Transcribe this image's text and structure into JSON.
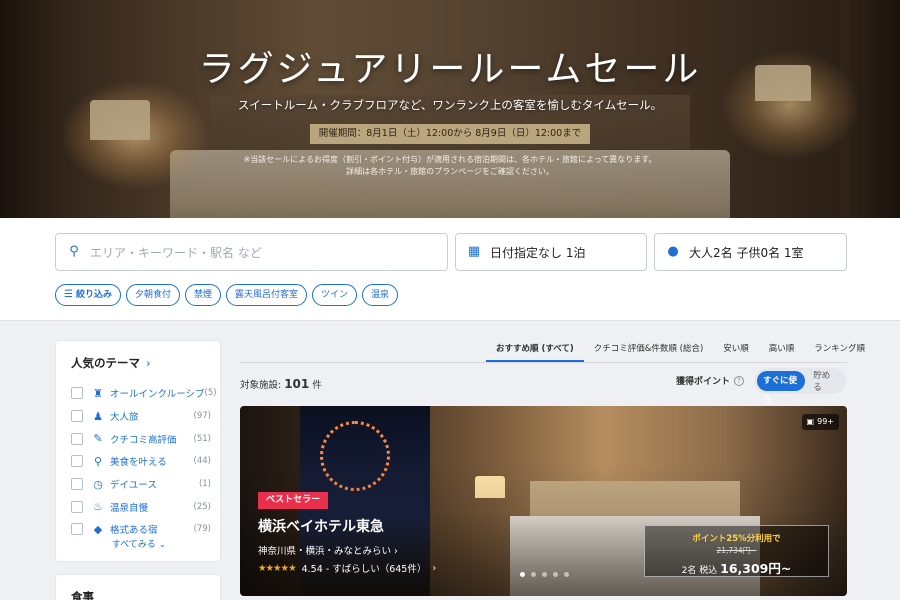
{
  "hero": {
    "title": "ラグジュアリールームセール",
    "subtitle": "スイートルーム・クラブフロアなど、ワンランク上の客室を愉しむタイムセール。",
    "period": "開催期間：8月1日（土）12:00から 8月9日（日）12:00まで",
    "note1": "※当該セールによるお得度（割引・ポイント付与）が適用される宿泊期間は、各ホテル・旅館によって異なります。",
    "note2": "詳細は各ホテル・旅館のプランページをご確認ください。"
  },
  "search": {
    "keyword_placeholder": "エリア・キーワード・駅名 など",
    "date_value": "日付指定なし 1泊",
    "guests_value": "大人2名  子供0名  1室"
  },
  "chips": [
    "絞り込み",
    "夕朝食付",
    "禁煙",
    "露天風呂付客室",
    "ツイン",
    "温泉"
  ],
  "themes": {
    "title": "人気のテーマ",
    "items": [
      {
        "label": "オールインクルーシブ",
        "count": "(5)",
        "icon": "all-inclusive-icon"
      },
      {
        "label": "大人旅",
        "count": "(97)",
        "icon": "couple-icon"
      },
      {
        "label": "クチコミ高評価",
        "count": "(51)",
        "icon": "review-icon"
      },
      {
        "label": "美食を叶える",
        "count": "(44)",
        "icon": "dining-icon"
      },
      {
        "label": "デイユース",
        "count": "(1)",
        "icon": "clock-icon"
      },
      {
        "label": "温泉自慢",
        "count": "(25)",
        "icon": "onsen-icon"
      },
      {
        "label": "格式ある宿",
        "count": "(79)",
        "icon": "diamond-icon"
      }
    ],
    "see_all": "すべてみる"
  },
  "food": {
    "title": "食事"
  },
  "sort": {
    "tabs": [
      "おすすめ順 (すべて)",
      "クチコミ評価&件数順 (総合)",
      "安い順",
      "高い順",
      "ランキング順"
    ],
    "active_index": 0
  },
  "results": {
    "prefix": "対象施設:",
    "count": "101",
    "suffix": "件"
  },
  "points": {
    "label": "獲得ポイント",
    "on": "すぐに使う",
    "off": "貯める"
  },
  "hotel": {
    "photos": "99+",
    "badge": "ベストセラー",
    "name": "横浜ベイホテル東急",
    "area": "神奈川県・横浜・みなとみらい",
    "stars": "★★★★★",
    "rating": "4.54 - すばらしい（645件）",
    "rating_value": 4.54,
    "promo": "ポイント25%分利用で",
    "original_price": "21,734円~",
    "price_prefix": "2名 税込",
    "price": "16,309円~",
    "slide_count": 5,
    "slide_active": 0
  },
  "colors": {
    "accent": "#1d6fd8",
    "badge": "#e8304d",
    "stars": "#f5a623",
    "promo": "#ffd24a"
  }
}
